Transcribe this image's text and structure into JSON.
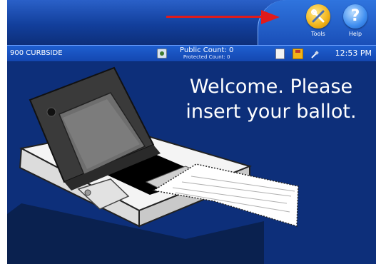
{
  "header": {
    "tools_label": "Tools",
    "help_label": "Help",
    "help_glyph": "?",
    "tools_icon": "tools-icon",
    "help_icon": "help-icon"
  },
  "annotation": {
    "arrow_color": "#e11b1b"
  },
  "status_bar": {
    "location": "900 CURBSIDE",
    "public_count": "Public Count: 0",
    "protected_count": "Protected Count: 0",
    "time": "12:53 PM",
    "icons": [
      "status-flag-icon",
      "document-icon",
      "disk-icon",
      "plug-icon"
    ]
  },
  "main": {
    "welcome_line1": "Welcome. Please",
    "welcome_line2": "insert your ballot.",
    "illustration": "ballot-scanner-illustration"
  },
  "colors": {
    "background": "#0d2f7a",
    "status_bar": "#1a55c4",
    "tools_button": "#f1b318",
    "help_button": "#3f8ef0"
  }
}
